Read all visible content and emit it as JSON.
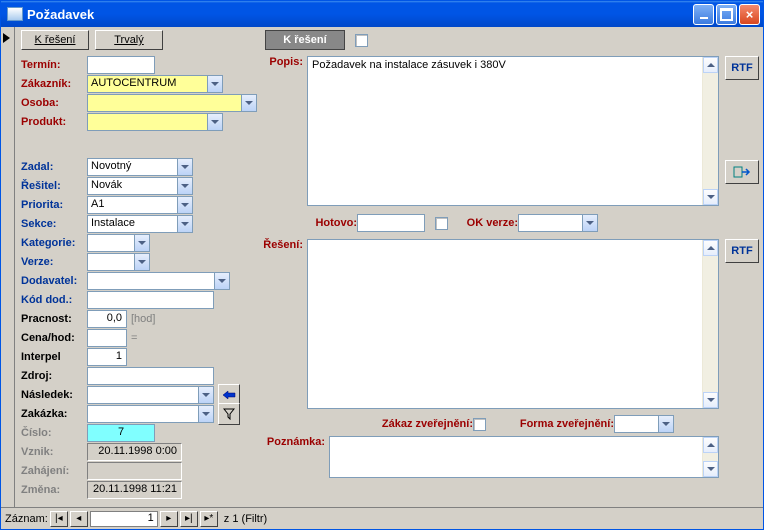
{
  "window": {
    "title": "Požadavek"
  },
  "top_buttons": {
    "kreseni": "K řešení",
    "trvaly": "Trvalý"
  },
  "top_right": {
    "kreseni": "K řešení"
  },
  "left": {
    "termin": {
      "label": "Termín:"
    },
    "zakaznik": {
      "label": "Zákazník:",
      "value": "AUTOCENTRUM"
    },
    "osoba": {
      "label": "Osoba:"
    },
    "produkt": {
      "label": "Produkt:"
    },
    "zadal": {
      "label": "Zadal:",
      "value": "Novotný"
    },
    "resitel": {
      "label": "Řešitel:",
      "value": "Novák"
    },
    "priorita": {
      "label": "Priorita:",
      "value": "A1"
    },
    "sekce": {
      "label": "Sekce:",
      "value": "Instalace"
    },
    "kategorie": {
      "label": "Kategorie:"
    },
    "verze": {
      "label": "Verze:"
    },
    "dodavatel": {
      "label": "Dodavatel:"
    },
    "koddod": {
      "label": "Kód dod.:"
    },
    "pracnost": {
      "label": "Pracnost:",
      "value": "0,0",
      "unit": "[hod]"
    },
    "cenahod": {
      "label": "Cena/hod:",
      "eq": "="
    },
    "interpel": {
      "label": "Interpel",
      "value": "1"
    },
    "zdroj": {
      "label": "Zdroj:"
    },
    "nasledek": {
      "label": "Následek:"
    },
    "zakazka": {
      "label": "Zakázka:"
    },
    "cislo": {
      "label": "Číslo:",
      "value": "7"
    },
    "vznik": {
      "label": "Vznik:",
      "value": "20.11.1998 0:00"
    },
    "zahajeni": {
      "label": "Zahájení:"
    },
    "zmena": {
      "label": "Změna:",
      "value": "20.11.1998 11:21"
    }
  },
  "right": {
    "popis_label": "Popis:",
    "popis_text": "Požadavek na instalace zásuvek i 380V",
    "rtf": "RTF",
    "hotovo": "Hotovo:",
    "okverze": "OK verze:",
    "reseni_label": "Řešení:",
    "zakaz": "Zákaz zveřejnění:",
    "forma": "Forma zveřejnění:",
    "poznamka": "Poznámka:"
  },
  "status": {
    "zaznam": "Záznam:",
    "current": "1",
    "total": "z  1 (Filtr)"
  }
}
